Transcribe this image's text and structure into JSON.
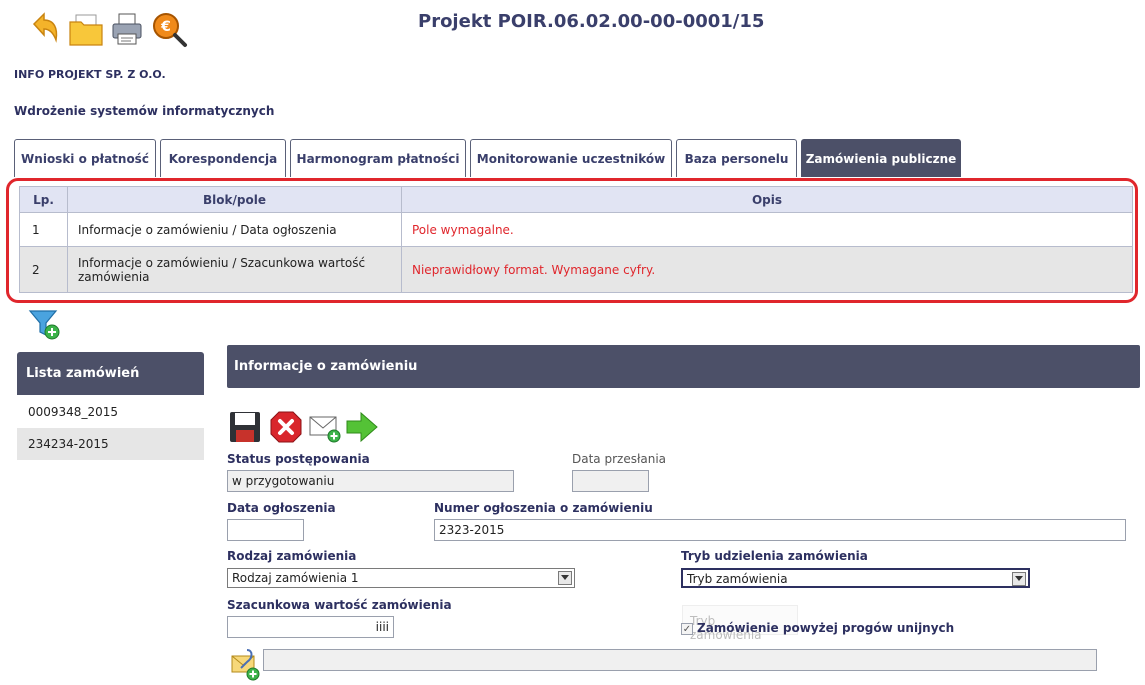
{
  "colors": {
    "accent_dark": "#4c5068",
    "error_red": "#e0262c",
    "title_blue": "#2d3060"
  },
  "toolbar": {
    "icons": [
      "back-arrow-icon",
      "folder-icon",
      "print-icon",
      "euro-search-icon"
    ]
  },
  "header": {
    "title": "Projekt POIR.06.02.00-00-0001/15",
    "company": "INFO PROJEKT SP. Z O.O.",
    "project_name": "Wdrożenie systemów informatycznych"
  },
  "tabs": [
    {
      "label": "Wnioski o płatność",
      "active": false
    },
    {
      "label": "Korespondencja",
      "active": false
    },
    {
      "label": "Harmonogram płatności",
      "active": false
    },
    {
      "label": "Monitorowanie uczestników",
      "active": false
    },
    {
      "label": "Baza personelu",
      "active": false
    },
    {
      "label": "Zamówienia publiczne",
      "active": true
    }
  ],
  "errors": {
    "columns": [
      "Lp.",
      "Blok/pole",
      "Opis"
    ],
    "rows": [
      {
        "lp": "1",
        "field": "Informacje o zamówieniu / Data ogłoszenia",
        "desc": "Pole wymagalne."
      },
      {
        "lp": "2",
        "field": "Informacje o zamówieniu / Szacunkowa wartość zamówienia",
        "desc": "Nieprawidłowy format. Wymagane cyfry."
      }
    ]
  },
  "sidebar": {
    "title": "Lista zamówień",
    "items": [
      "0009348_2015",
      "234234-2015"
    ]
  },
  "section": {
    "title": "Informacje o zamówieniu"
  },
  "actions": [
    "save-icon",
    "delete-icon",
    "send-mail-icon",
    "next-arrow-icon"
  ],
  "form": {
    "status_label": "Status postępowania",
    "status_value": "w przygotowaniu",
    "sent_date_label": "Data przesłania",
    "sent_date_value": "",
    "announce_date_label": "Data ogłoszenia",
    "announce_date_value": "",
    "announce_number_label": "Numer ogłoszenia o zamówieniu",
    "announce_number_value": "2323-2015",
    "order_type_label": "Rodzaj zamówienia",
    "order_type_value": "Rodzaj zamówienia 1",
    "mode_label": "Tryb udzielenia zamówienia",
    "mode_value": "Tryb zamówienia",
    "mode_tooltip": "Tryb zamówienia",
    "estimated_value_label": "Szacunkowa wartość zamówienia",
    "estimated_value_value": "iiii",
    "above_threshold_label": "Zamówienie powyżej progów unijnych",
    "above_threshold_checked": true
  }
}
